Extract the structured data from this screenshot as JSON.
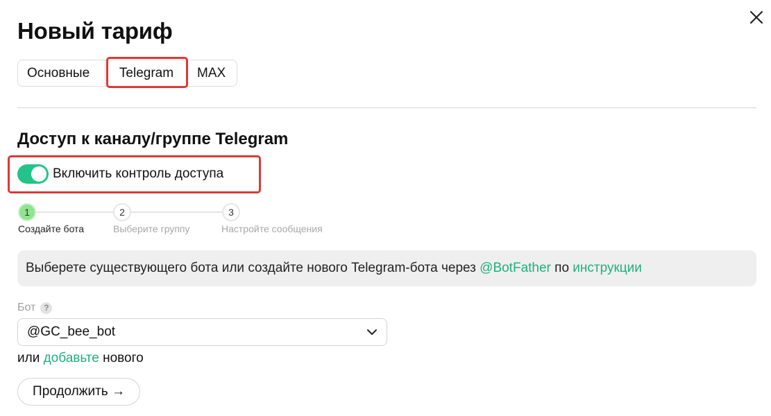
{
  "title": "Новый тариф",
  "close_icon": "close-icon",
  "tabs": [
    {
      "label": "Основные"
    },
    {
      "label": "Telegram"
    },
    {
      "label": "MAX"
    }
  ],
  "active_tab": "Telegram",
  "section_title": "Доступ к каналу/группе Telegram",
  "access_toggle": {
    "label": "Включить контроль доступа",
    "enabled": true
  },
  "steps": [
    {
      "number": "1",
      "label": "Создайте бота"
    },
    {
      "number": "2",
      "label": "Выберите группу"
    },
    {
      "number": "3",
      "label": "Настройте сообщения"
    }
  ],
  "current_step": 1,
  "info": {
    "text_before": "Выберете существующего бота или создайте нового Telegram-бота через ",
    "botfather_link": "@BotFather",
    "text_middle": " по ",
    "instructions_link": "инструкции"
  },
  "bot_field": {
    "label": "Бот",
    "help": "?",
    "value": "@GC_bee_bot"
  },
  "add_new": {
    "prefix": "или ",
    "link": "добавьте",
    "suffix": " нового"
  },
  "continue_button": "Продолжить →",
  "colors": {
    "accent": "#23c48a",
    "link": "#1fb07e",
    "highlight": "#d93a35",
    "active_step": "#8de58e",
    "info_bg": "#efefef"
  }
}
